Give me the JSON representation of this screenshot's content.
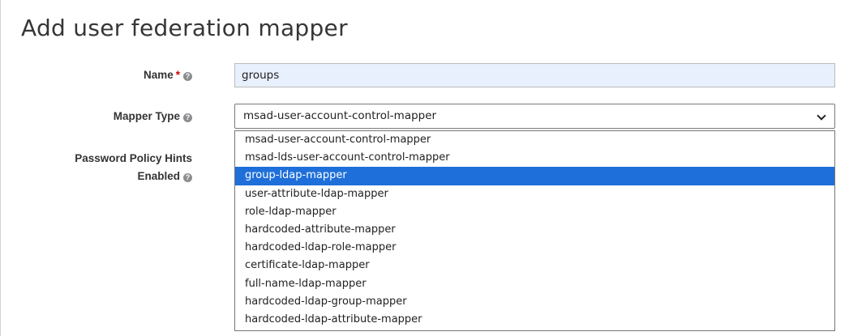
{
  "page": {
    "title": "Add user federation mapper"
  },
  "form": {
    "name_label": "Name",
    "required_mark": "*",
    "name_value": "groups",
    "mapper_type_label": "Mapper Type",
    "mapper_type_selected": "msad-user-account-control-mapper",
    "password_hints_label_line1": "Password Policy Hints",
    "password_hints_label_line2": "Enabled",
    "help_glyph": "?"
  },
  "dropdown": {
    "highlighted_index": 2,
    "options": [
      "msad-user-account-control-mapper",
      "msad-lds-user-account-control-mapper",
      "group-ldap-mapper",
      "user-attribute-ldap-mapper",
      "role-ldap-mapper",
      "hardcoded-attribute-mapper",
      "hardcoded-ldap-role-mapper",
      "certificate-ldap-mapper",
      "full-name-ldap-mapper",
      "hardcoded-ldap-group-mapper",
      "hardcoded-ldap-attribute-mapper"
    ]
  },
  "icons": {
    "help": "question-circle-icon",
    "select_arrow": "chevron-down-icon"
  }
}
